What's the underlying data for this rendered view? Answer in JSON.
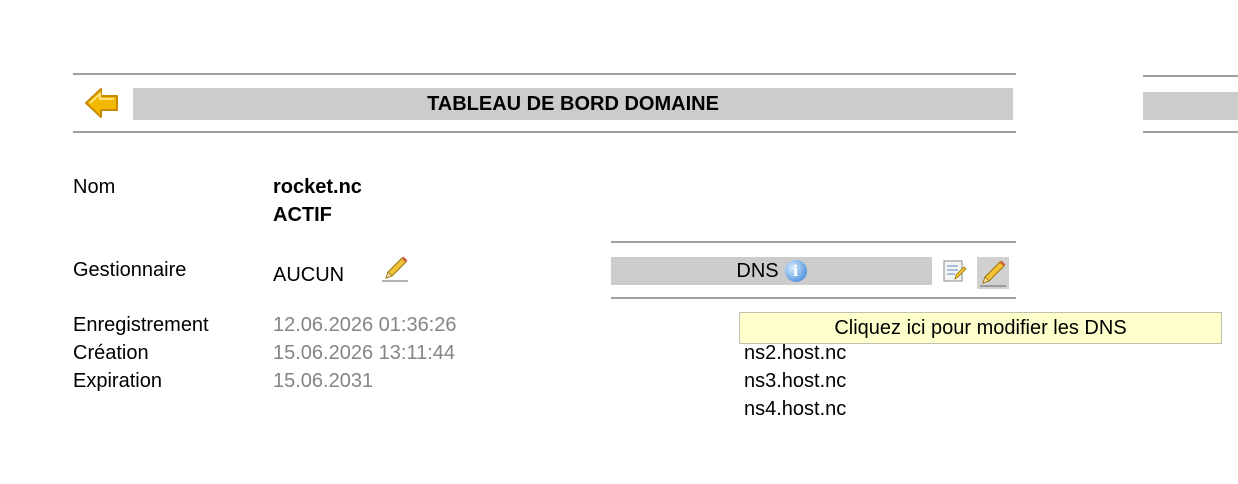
{
  "header": {
    "title": "TABLEAU DE BORD DOMAINE"
  },
  "icons": {
    "back": "back-arrow-icon",
    "edit": "pencil-icon",
    "info": "info-icon",
    "notepad": "notepad-icon"
  },
  "domain": {
    "name_label": "Nom",
    "name": "rocket.nc",
    "status": "ACTIF",
    "manager_label": "Gestionnaire",
    "manager": "AUCUN",
    "registration_label": "Enregistrement",
    "registration": "12.06.2026 01:36:26",
    "creation_label": "Création",
    "creation": "15.06.2026 13:11:44",
    "expiration_label": "Expiration",
    "expiration": "15.06.2031"
  },
  "dns": {
    "title": "DNS",
    "info_glyph": "i",
    "tooltip": "Cliquez ici pour modifier les DNS",
    "servers": [
      "ns2.host.nc",
      "ns3.host.nc",
      "ns4.host.nc"
    ]
  },
  "colors": {
    "bar": "#cccccc",
    "rule": "#a0a0a0",
    "muted_text": "#858585",
    "tooltip_bg": "#ffffcc",
    "arrow": "#f5b800"
  }
}
